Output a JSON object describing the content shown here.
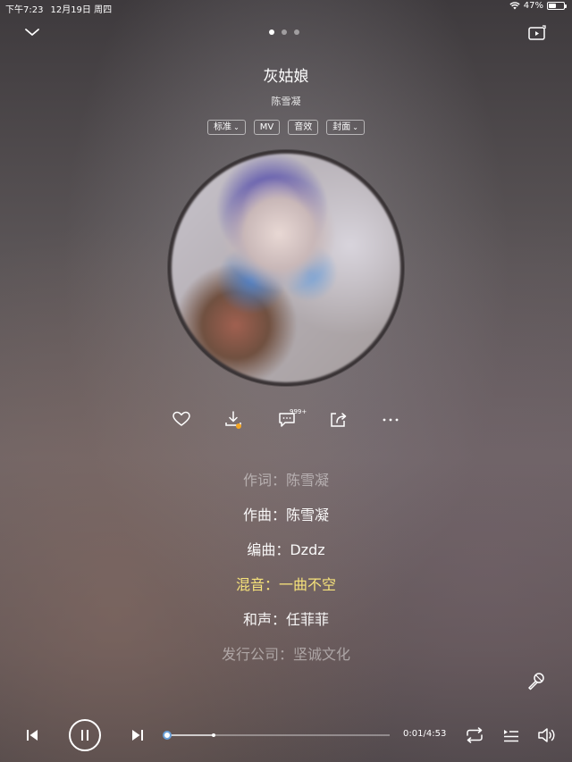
{
  "status_bar": {
    "time": "下午7:23",
    "date": "12月19日 周四",
    "battery_percent": "47%",
    "battery_level": 0.47
  },
  "header": {
    "page_count": 3,
    "active_page": 0
  },
  "song": {
    "title": "灰姑娘",
    "artist": "陈雪凝"
  },
  "tags": [
    {
      "label": "标准",
      "has_dropdown": true
    },
    {
      "label": "MV",
      "has_dropdown": false
    },
    {
      "label": "音效",
      "has_dropdown": false
    },
    {
      "label": "封面",
      "has_dropdown": true
    }
  ],
  "actions": {
    "comment_count": "999+"
  },
  "credits": [
    {
      "text": "作词：陈雪凝",
      "state": "dim"
    },
    {
      "text": "作曲：陈雪凝",
      "state": "normal"
    },
    {
      "text": "编曲：Dzdz",
      "state": "normal"
    },
    {
      "text": "混音：一曲不空",
      "state": "current"
    },
    {
      "text": "和声：任菲菲",
      "state": "normal"
    },
    {
      "text": "发行公司：坚诚文化",
      "state": "dim"
    }
  ],
  "player": {
    "current_time": "0:01",
    "separator": "/",
    "total_time": "4:53",
    "progress_fraction": 0.0034,
    "buffer_fraction": 0.21
  },
  "colors": {
    "current_line": "#f6e27a",
    "download_badge": "#f5a623"
  },
  "icons": [
    "chevron-down-icon",
    "cast-icon",
    "heart-icon",
    "download-icon",
    "comment-icon",
    "share-icon",
    "more-icon",
    "microphone-icon",
    "previous-icon",
    "pause-icon",
    "next-icon",
    "repeat-icon",
    "queue-icon",
    "volume-icon",
    "wifi-icon",
    "battery-icon"
  ]
}
